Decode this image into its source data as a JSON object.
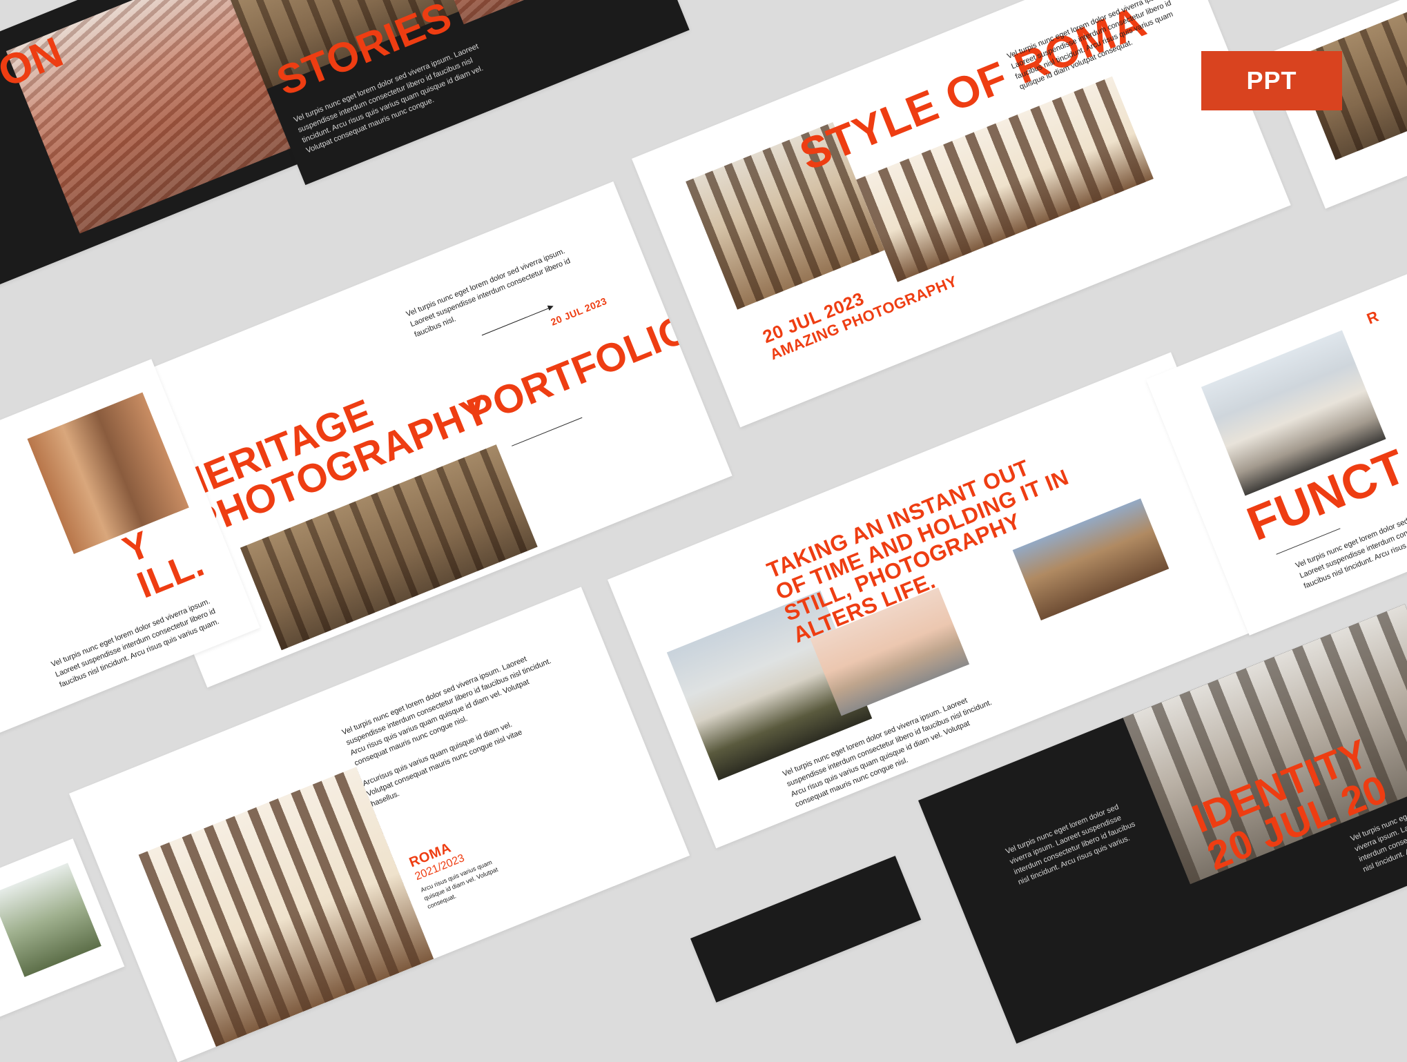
{
  "badge": {
    "label": "PPT"
  },
  "slides": {
    "identity_left": {
      "title": "ON"
    },
    "stories": {
      "title": "STORIES",
      "body": "Vel turpis nunc eget lorem dolor sed viverra ipsum. Laoreet suspendisse interdum consectetur libero id faucibus nisl tincidunt. Arcu risus quis varius quam quisque id diam vel. Volutpat consequat mauris nunc congue."
    },
    "style_of_roma": {
      "title": "STYLE OF ROMA",
      "body": "Vel turpis nunc eget lorem dolor sed viverra ipsum. Laoreet suspendisse interdum consectetur libero id faucibus nisl tincidunt. Arcu risus quis varius quam quisque id diam volutpat consequat.",
      "date": "20 JUL 2023",
      "subtitle": "AMAZING PHOTOGRAPHY"
    },
    "cover": {
      "line1": "HERITAGE",
      "line2": "PHOTOGRAPHY",
      "line3": "PORTFOLIO",
      "date": "20 JUL 2023",
      "body": "Vel turpis nunc eget lorem dolor sed viverra ipsum. Laoreet suspendisse interdum consectetur libero id faucibus nisl."
    },
    "left_partial": {
      "title_a": "Y",
      "title_b": "ILL.",
      "body": "Vel turpis nunc eget lorem dolor sed viverra ipsum. Laoreet suspendisse interdum consectetur libero id faucibus nisl tincidunt. Arcu risus quis varius quam."
    },
    "quote": {
      "text": "TAKING AN INSTANT OUT OF TIME AND HOLDING IT IN STILL, PHOTOGRAPHY ALTERS LIFE.",
      "body": "Vel turpis nunc eget lorem dolor sed viverra ipsum. Laoreet suspendisse interdum consectetur libero id faucibus nisl tincidunt. Arcu risus quis varius quam quisque id diam vel. Volutpat consequat mauris nunc congue nisl."
    },
    "function": {
      "title": "FUNCT",
      "body": "Vel turpis nunc eget lorem dolor sed viverra ipsum. Laoreet suspendisse interdum consectetur libero id faucibus nisl tincidunt. Arcu risus quis varius quam.",
      "side_label": "R"
    },
    "roma": {
      "body1": "Vel turpis nunc eget lorem dolor sed viverra ipsum. Laoreet suspendisse interdum consectetur libero id faucibus nisl tincidunt. Arcu risus quis varius quam quisque id diam vel. Volutpat consequat mauris nunc congue nisl.",
      "body2": "Arcurisus quis varius quam quisque id diam vel. Volutpat consequat mauris nunc congue nisl vitae hasellus.",
      "label": "ROMA",
      "years": "2021/2023",
      "caption": "Arcu risus quis varius quam quisque id diam vel. Volutpat consequat."
    },
    "identity": {
      "title": "IDENTITY",
      "date": "20 JUL 20",
      "body": "Vel turpis nunc eget lorem dolor sed viverra ipsum. Laoreet suspendisse interdum consectetur libero id faucibus nisl tincidunt. Arcu risus quis varius.",
      "body2": "Vel turpis nunc eget lorem dolor sed viverra ipsum. Laoreet suspendisse interdum consectetur libero id faucibus nisl tincidunt. Ar"
    },
    "bottom_dark": {
      "body": "Vel turpis nunc eget lorem dolor sed viverra ipsum. Laoreet suspendisse interdum consectetur libero id faucibus nisl tincidunt. Arcu risus quis varius."
    }
  },
  "colors": {
    "accent": "#ee3d12",
    "dark": "#1b1b1b",
    "background": "#dcdcdc",
    "badge": "#d9431f"
  }
}
